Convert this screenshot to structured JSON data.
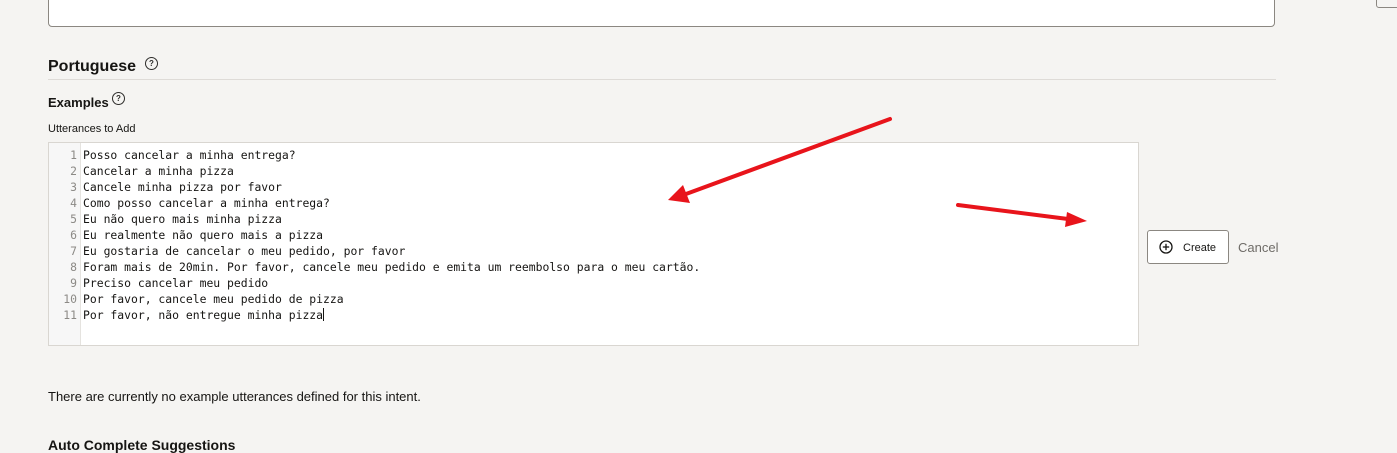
{
  "top_field": {
    "value": ""
  },
  "language_section": {
    "title": "Portuguese",
    "help_icon": "question-circle-icon"
  },
  "examples": {
    "label": "Examples",
    "help_icon": "question-circle-icon"
  },
  "utterances": {
    "label": "Utterances to Add",
    "lines": [
      {
        "num": "1",
        "text": "Posso cancelar a minha entrega?"
      },
      {
        "num": "2",
        "text": "Cancelar a minha pizza"
      },
      {
        "num": "3",
        "text": "Cancele minha pizza por favor"
      },
      {
        "num": "4",
        "text": "Como posso cancelar a minha entrega?"
      },
      {
        "num": "5",
        "text": "Eu não quero mais minha pizza"
      },
      {
        "num": "6",
        "text": "Eu realmente não quero mais a pizza"
      },
      {
        "num": "7",
        "text": "Eu gostaria de cancelar o meu pedido, por favor"
      },
      {
        "num": "8",
        "text": "Foram mais de 20min. Por favor, cancele meu pedido e emita um reembolso para o meu cartão."
      },
      {
        "num": "9",
        "text": "Preciso cancelar meu pedido"
      },
      {
        "num": "10",
        "text": "Por favor, cancele meu pedido de pizza"
      },
      {
        "num": "11",
        "text": "Por favor, não entregue minha pizza"
      }
    ]
  },
  "actions": {
    "create_label": "Create",
    "create_icon": "plus-circle-icon",
    "cancel_label": "Cancel"
  },
  "empty_message": "There are currently no example utterances defined for this intent.",
  "next_section_partial": "Auto Complete Suggestions",
  "annotation": {
    "arrow_color": "#e8141b"
  }
}
